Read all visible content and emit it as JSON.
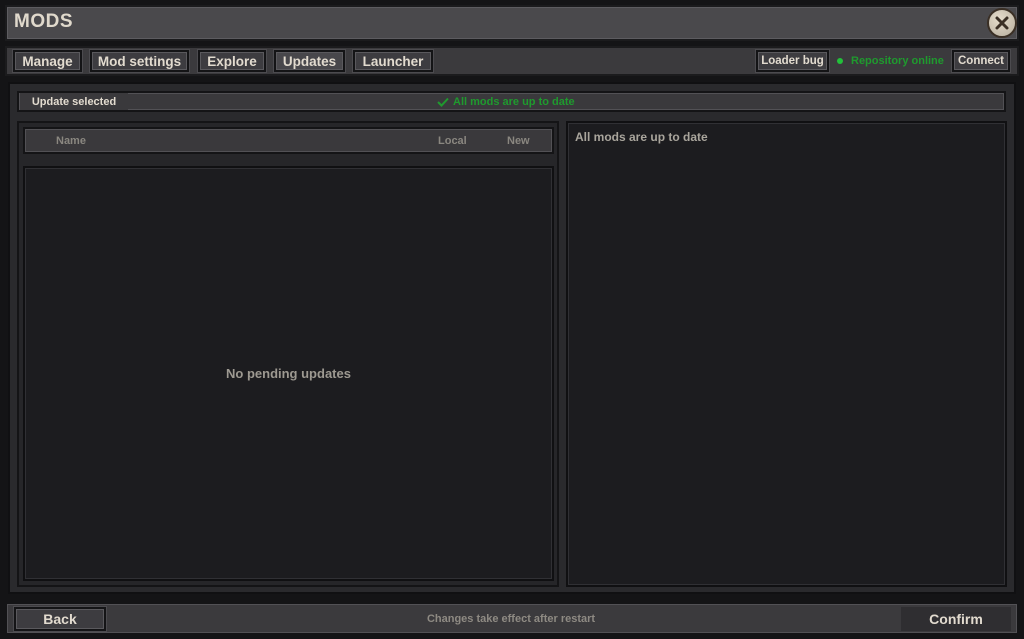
{
  "window": {
    "title": "MODS"
  },
  "tabs": [
    {
      "label": "Manage"
    },
    {
      "label": "Mod settings"
    },
    {
      "label": "Explore"
    },
    {
      "label": "Updates",
      "selected": true
    },
    {
      "label": "Launcher"
    }
  ],
  "toolbar": {
    "loader_bug_label": "Loader bug",
    "repository_status": "Repository online",
    "connect_label": "Connect"
  },
  "updates": {
    "update_selected_label": "Update selected",
    "status_message": "All mods are up to date",
    "columns": {
      "name": "Name",
      "local": "Local",
      "new": "New"
    },
    "empty_message": "No pending updates",
    "detail_text": "All mods are up to date"
  },
  "footer": {
    "back_label": "Back",
    "note": "Changes take effect after restart",
    "confirm_label": "Confirm"
  },
  "colors": {
    "status_green": "#22c03a",
    "accent_text": "#e2dbcf"
  },
  "icons": {
    "close": "close-icon",
    "status_dot": "status-dot-icon",
    "check": "check-icon"
  }
}
